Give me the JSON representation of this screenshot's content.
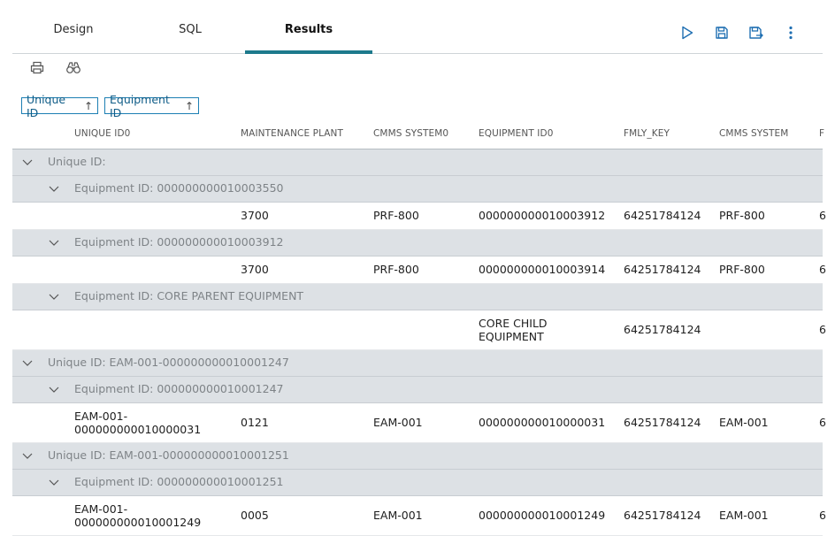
{
  "tabs": {
    "design": "Design",
    "sql": "SQL",
    "results": "Results"
  },
  "toolbar_icons": [
    "play-icon",
    "save-icon",
    "save-as-icon",
    "more-vertical-icon"
  ],
  "subtoolbar_icons": [
    "print-icon",
    "binoculars-icon"
  ],
  "group_chips": [
    {
      "label": "Unique ID",
      "sort": "↑"
    },
    {
      "label": "Equipment ID",
      "sort": "↑"
    }
  ],
  "columns": [
    "UNIQUE ID0",
    "MAINTENANCE PLANT",
    "CMMS SYSTEM0",
    "EQUIPMENT ID0",
    "FMLY_KEY",
    "CMMS SYSTEM",
    "F"
  ],
  "groups": [
    {
      "label": "Unique ID:",
      "subgroups": [
        {
          "label": "Equipment ID: 000000000010003550",
          "rows": [
            {
              "unique_id": "",
              "maintenance_plant": "3700",
              "cmms_system0": "PRF-800",
              "equipment_id0": "000000000010003912",
              "fmly_key": "64251784124",
              "cmms_system": "PRF-800",
              "overflow": "6"
            }
          ]
        },
        {
          "label": "Equipment ID: 000000000010003912",
          "rows": [
            {
              "unique_id": "",
              "maintenance_plant": "3700",
              "cmms_system0": "PRF-800",
              "equipment_id0": "000000000010003914",
              "fmly_key": "64251784124",
              "cmms_system": "PRF-800",
              "overflow": "6"
            }
          ]
        },
        {
          "label": "Equipment ID: CORE PARENT EQUIPMENT",
          "rows": [
            {
              "unique_id": "",
              "maintenance_plant": "",
              "cmms_system0": "",
              "equipment_id0_line1": "CORE CHILD",
              "equipment_id0_line2": "EQUIPMENT",
              "fmly_key": "64251784124",
              "cmms_system": "",
              "overflow": "6"
            }
          ]
        }
      ]
    },
    {
      "label": "Unique ID: EAM-001-000000000010001247",
      "subgroups": [
        {
          "label": "Equipment ID: 000000000010001247",
          "rows": [
            {
              "unique_id_line1": "EAM-001-",
              "unique_id_line2": "000000000010000031",
              "maintenance_plant": "0121",
              "cmms_system0": "EAM-001",
              "equipment_id0": "000000000010000031",
              "fmly_key": "64251784124",
              "cmms_system": "EAM-001",
              "overflow": "6"
            }
          ]
        }
      ]
    },
    {
      "label": "Unique ID: EAM-001-000000000010001251",
      "subgroups": [
        {
          "label": "Equipment ID: 000000000010001251",
          "rows": [
            {
              "unique_id_line1": "EAM-001-",
              "unique_id_line2": "000000000010001249",
              "maintenance_plant": "0005",
              "cmms_system0": "EAM-001",
              "equipment_id0": "000000000010001249",
              "fmly_key": "64251784124",
              "cmms_system": "EAM-001",
              "overflow": "6"
            }
          ]
        }
      ]
    }
  ],
  "colors": {
    "accent": "#1d7a8c",
    "icon": "#1f6fb2",
    "group_bg": "#dde1e5",
    "chip_border": "#1d7fb3"
  }
}
